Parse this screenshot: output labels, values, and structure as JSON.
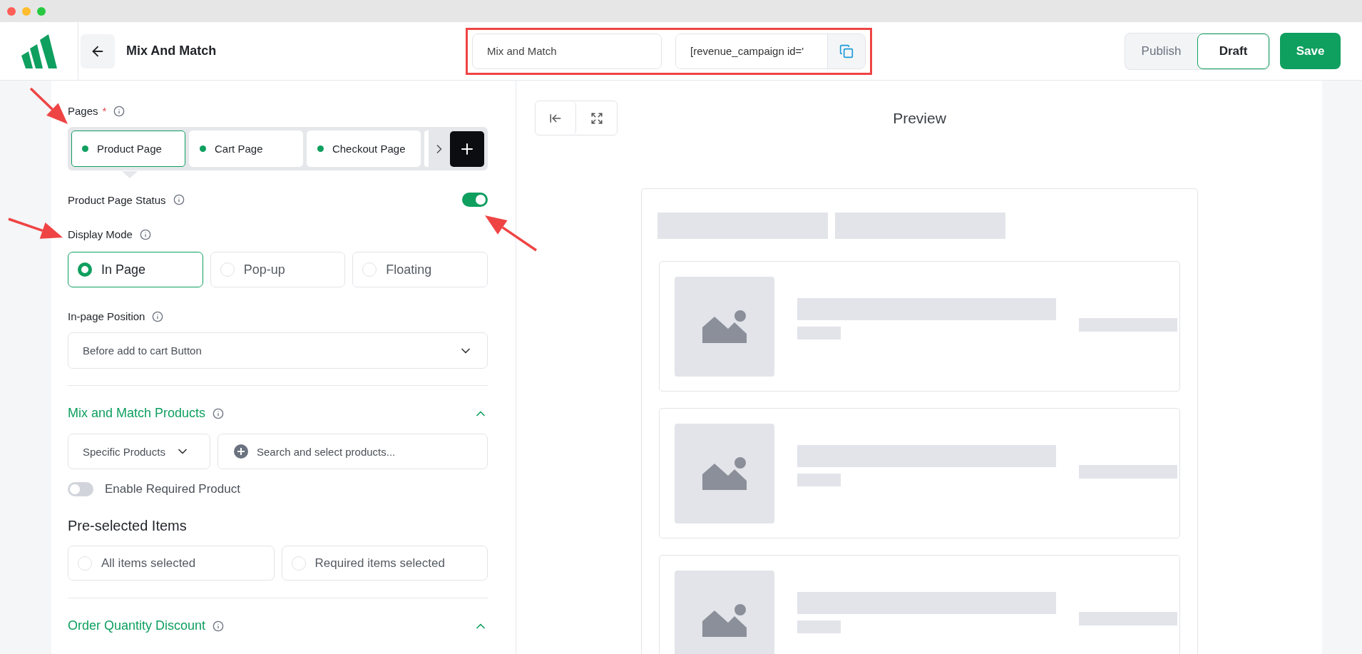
{
  "header": {
    "title": "Mix And Match",
    "campaign_name": {
      "value": "Mix and Match"
    },
    "shortcode": {
      "value": "[revenue_campaign id='"
    },
    "status_options": [
      {
        "label": "Publish",
        "selected": false
      },
      {
        "label": "Draft",
        "selected": true
      }
    ],
    "save_button": "Save"
  },
  "pages": {
    "label": "Pages",
    "required_mark": "*",
    "tabs": [
      {
        "label": "Product Page",
        "selected": true
      },
      {
        "label": "Cart Page",
        "selected": false
      },
      {
        "label": "Checkout Page",
        "selected": false
      }
    ]
  },
  "page_status": {
    "label": "Product Page Status",
    "on": true
  },
  "display_mode": {
    "label": "Display Mode",
    "options": [
      {
        "label": "In Page",
        "selected": true
      },
      {
        "label": "Pop-up",
        "selected": false
      },
      {
        "label": "Floating",
        "selected": false
      }
    ]
  },
  "in_page_position": {
    "label": "In-page Position",
    "value": "Before add to cart Button"
  },
  "mix_and_match": {
    "title": "Mix and Match Products",
    "expanded": true,
    "product_scope": "Specific Products",
    "search": {
      "placeholder": "Search and select products..."
    },
    "required_product": {
      "label": "Enable Required Product",
      "on": false
    },
    "preselected": {
      "title": "Pre-selected Items",
      "options": [
        {
          "label": "All items selected",
          "selected": false
        },
        {
          "label": "Required items selected",
          "selected": false
        }
      ]
    }
  },
  "order_quantity_discount": {
    "title": "Order Quantity Discount",
    "expanded": true
  },
  "preview": {
    "title": "Preview",
    "items": [
      {
        "kind": "placeholder"
      },
      {
        "kind": "placeholder"
      },
      {
        "kind": "placeholder"
      }
    ]
  }
}
